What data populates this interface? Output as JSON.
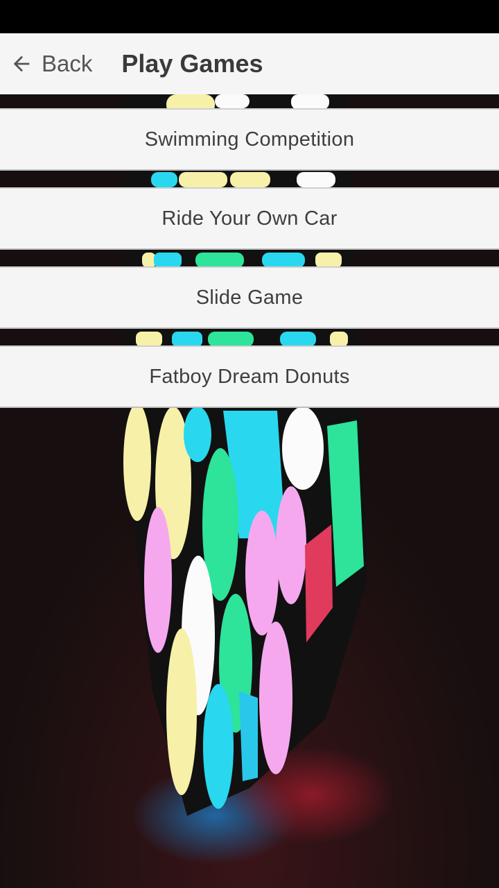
{
  "header": {
    "back_label": "Back",
    "title": "Play Games",
    "back_icon": "arrow-left-icon"
  },
  "games": [
    {
      "label": "Swimming Competition"
    },
    {
      "label": "Ride Your Own Car"
    },
    {
      "label": "Slide Game"
    },
    {
      "label": "Fatboy Dream Donuts"
    }
  ],
  "colors": {
    "app_bar": "#f5f5f5",
    "status_bar": "#000000",
    "button_bg": "#f5f5f5",
    "text": "#3e3e3e",
    "background": "#1a1212"
  },
  "background_image": "glowing-puzzle-cube-photo"
}
